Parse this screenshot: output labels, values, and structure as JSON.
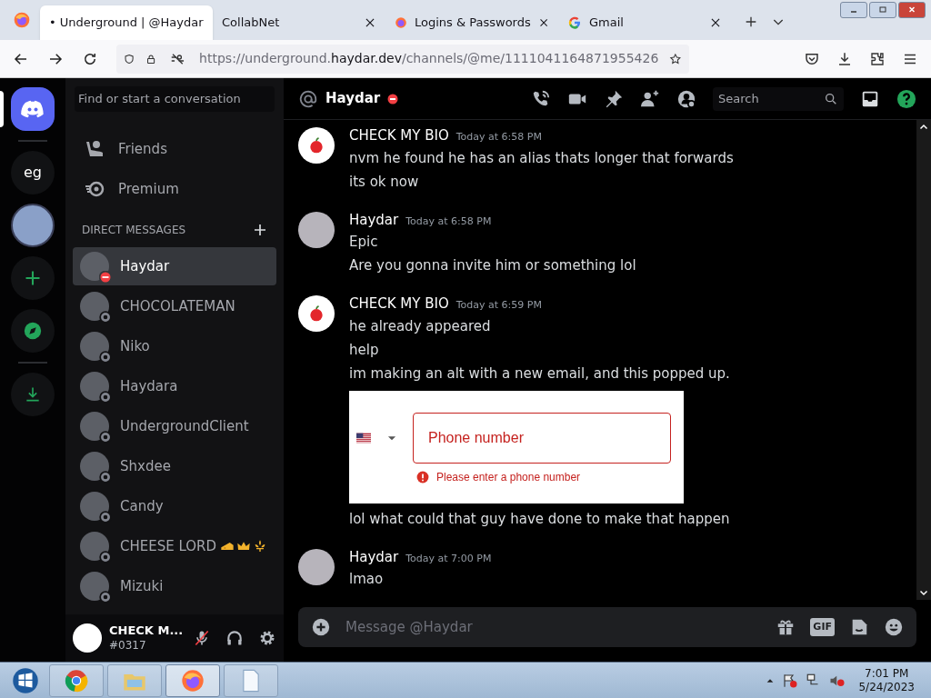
{
  "browser": {
    "tabs": [
      {
        "label": "• Underground | @Haydar",
        "selected": true,
        "kind": "plain"
      },
      {
        "label": "CollabNet",
        "selected": false,
        "kind": "plain"
      },
      {
        "label": "Logins & Passwords",
        "selected": false,
        "kind": "firefox"
      },
      {
        "label": "Gmail",
        "selected": false,
        "kind": "google"
      }
    ],
    "url": {
      "prefix": "https://underground.",
      "host": "haydar.dev",
      "path": "/channels/@me/1111041164871955426"
    }
  },
  "servers": [
    {
      "kind": "home",
      "selected": true
    },
    {
      "kind": "text",
      "selected": false,
      "label": "eg"
    },
    {
      "kind": "avatar",
      "selected": false
    },
    {
      "kind": "add",
      "selected": false
    },
    {
      "kind": "explore",
      "selected": false
    },
    {
      "kind": "download",
      "selected": false
    }
  ],
  "sidebar": {
    "search_placeholder": "Find or start a conversation",
    "nav": [
      {
        "kind": "friends",
        "label": "Friends"
      },
      {
        "kind": "premium",
        "label": "Premium"
      }
    ],
    "section_title": "DIRECT MESSAGES",
    "dms": [
      {
        "name": "Haydar",
        "kind": "dnd",
        "selected": true
      },
      {
        "name": "CHOCOLATEMAN",
        "kind": "offline",
        "selected": false
      },
      {
        "name": "Niko",
        "kind": "offline",
        "selected": false
      },
      {
        "name": "Haydara",
        "kind": "offline",
        "selected": false
      },
      {
        "name": "UndergroundClient",
        "kind": "offline",
        "selected": false
      },
      {
        "name": "Shxdee",
        "kind": "offline",
        "selected": false
      },
      {
        "name": "Candy",
        "kind": "offline",
        "selected": false
      },
      {
        "name": "CHEESE LORD",
        "kind": "offline",
        "selected": false,
        "badges": [
          {
            "kind": "cheese"
          },
          {
            "kind": "crown"
          },
          {
            "kind": "emblem"
          }
        ]
      },
      {
        "name": "Mizuki",
        "kind": "offline",
        "selected": false
      }
    ],
    "user": {
      "name": "CHECK M...",
      "tag": "#0317",
      "mic_muted": true
    }
  },
  "chat": {
    "recipient": {
      "name": "Haydar",
      "kind": "dnd"
    },
    "search_placeholder": "Search",
    "messages": [
      {
        "author": "CHECK MY BIO",
        "time": "Today at 6:58 PM",
        "kind": "apple",
        "items": [
          {
            "kind": "text",
            "text": "nvm he found he has an alias thats longer that forwards"
          },
          {
            "kind": "text",
            "text": "its ok now"
          }
        ]
      },
      {
        "author": "Haydar",
        "time": "Today at 6:58 PM",
        "kind": "user",
        "items": [
          {
            "kind": "text",
            "text": "Epic"
          },
          {
            "kind": "text",
            "text": "Are you gonna invite him or something lol"
          }
        ]
      },
      {
        "author": "CHECK MY BIO",
        "time": "Today at 6:59 PM",
        "kind": "apple",
        "items": [
          {
            "kind": "text",
            "text": "he already appeared"
          },
          {
            "kind": "text",
            "text": "help"
          },
          {
            "kind": "text",
            "text": "im making an alt with a new email, and this popped up."
          },
          {
            "kind": "phone_form",
            "placeholder": "Phone number",
            "error": "Please enter a phone number"
          },
          {
            "kind": "text",
            "text": "lol what could that guy have done to make that happen"
          }
        ]
      },
      {
        "author": "Haydar",
        "time": "Today at 7:00 PM",
        "kind": "user",
        "items": [
          {
            "kind": "text",
            "text": "lmao"
          }
        ]
      }
    ],
    "composer_placeholder": "Message @Haydar",
    "gif_label": "GIF"
  },
  "taskbar": {
    "apps": [
      {
        "kind": "chrome",
        "selected": false
      },
      {
        "kind": "explorer",
        "selected": false
      },
      {
        "kind": "firefox",
        "selected": true
      },
      {
        "kind": "notepad",
        "selected": false
      }
    ],
    "time": "7:01 PM",
    "date": "5/24/2023"
  }
}
